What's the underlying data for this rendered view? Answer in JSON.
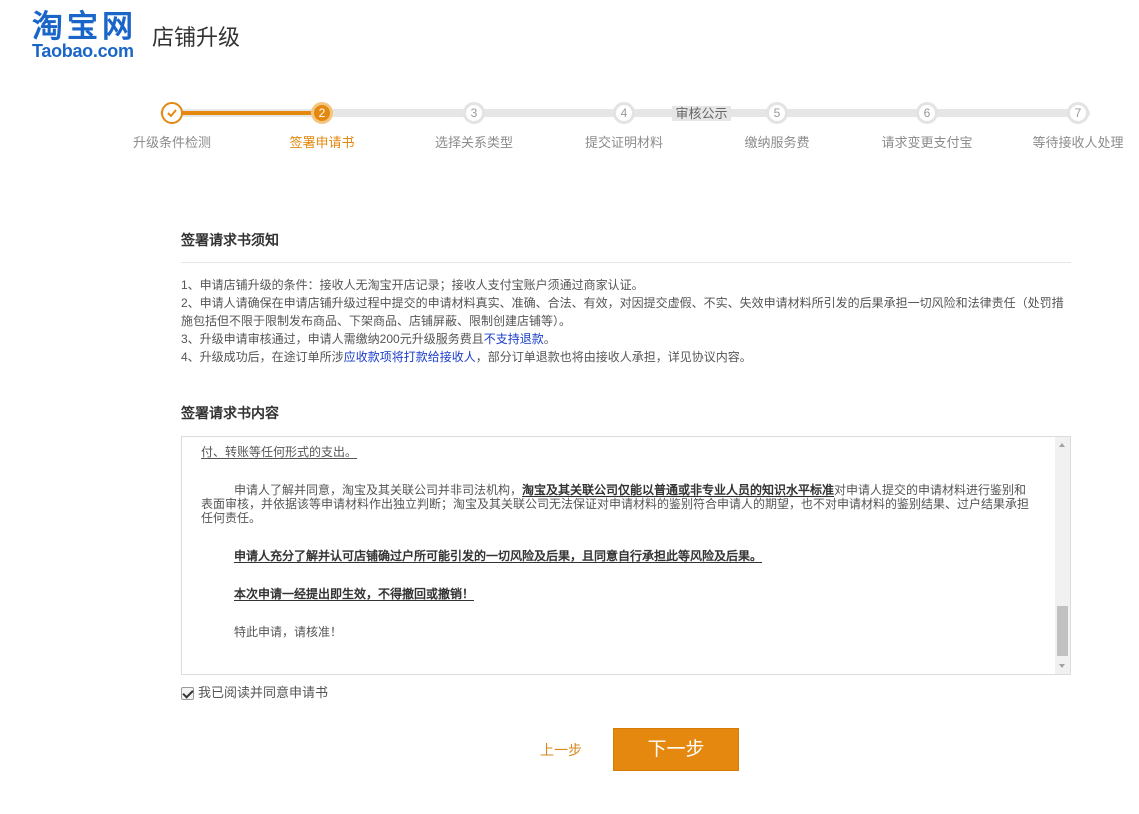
{
  "header": {
    "logo_cn": "淘宝网",
    "logo_en": "Taobao.com",
    "title": "店铺升级"
  },
  "stepper": {
    "current_step": 2,
    "steps": [
      {
        "label": "升级条件检测",
        "icon": "check-icon"
      },
      {
        "number": "2",
        "label": "签署申请书"
      },
      {
        "number": "3",
        "label": "选择关系类型"
      },
      {
        "number": "4",
        "label": "提交证明材料"
      },
      {
        "number": "5",
        "label": "缴纳服务费"
      },
      {
        "number": "6",
        "label": "请求变更支付宝"
      },
      {
        "number": "7",
        "label": "等待接收人处理"
      }
    ],
    "review_tag": "审核公示"
  },
  "notice": {
    "title": "签署请求书须知",
    "items": [
      {
        "text": "1、申请店铺升级的条件：接收人无淘宝开店记录；接收人支付宝账户须通过商家认证。"
      },
      {
        "text": "2、申请人请确保在申请店铺升级过程中提交的申请材料真实、准确、合法、有效，对因提交虚假、不实、失效申请材料所引发的后果承担一切风险和法律责任（处罚措施包括但不限于限制发布商品、下架商品、店铺屏蔽、限制创建店铺等）。"
      },
      {
        "before": "3、升级申请审核通过，申请人需缴纳200元升级服务费且",
        "link": "不支持退款",
        "after": "。"
      },
      {
        "before": "4、升级成功后，在途订单所涉",
        "link": "应收款项将打款给接收人",
        "after": "，部分订单退款也将由接收人承担，详见协议内容。"
      }
    ]
  },
  "agreement": {
    "title": "签署请求书内容",
    "paragraphs": [
      {
        "text": "付、转账等任何形式的支出。"
      },
      {
        "before": "申请人了解并同意，淘宝及其关联公司并非司法机构，",
        "bold": "淘宝及其关联公司仅能以普通或非专业人员的知识水平标准",
        "after": "对申请人提交的申请材料进行鉴别和表面审核，并依据该等申请材料作出独立判断；淘宝及其关联公司无法保证对申请材料的鉴别符合申请人的期望，也不对申请材料的鉴别结果、过户结果承担任何责任。"
      },
      {
        "text": "申请人充分了解并认可店铺确过户所可能引发的一切风险及后果，且同意自行承担此等风险及后果。"
      },
      {
        "text": "本次申请一经提出即生效，不得撤回或撤销！"
      },
      {
        "text": "特此申请，请核准！"
      }
    ],
    "scroll_percent": 99
  },
  "consent": {
    "label": "我已阅读并同意申请书",
    "checked": true
  },
  "actions": {
    "prev_label": "上一步",
    "next_label": "下一步"
  },
  "theme": {
    "accent": "#e4880f",
    "link": "#1a3cc8",
    "logo": "#1a66c8"
  }
}
